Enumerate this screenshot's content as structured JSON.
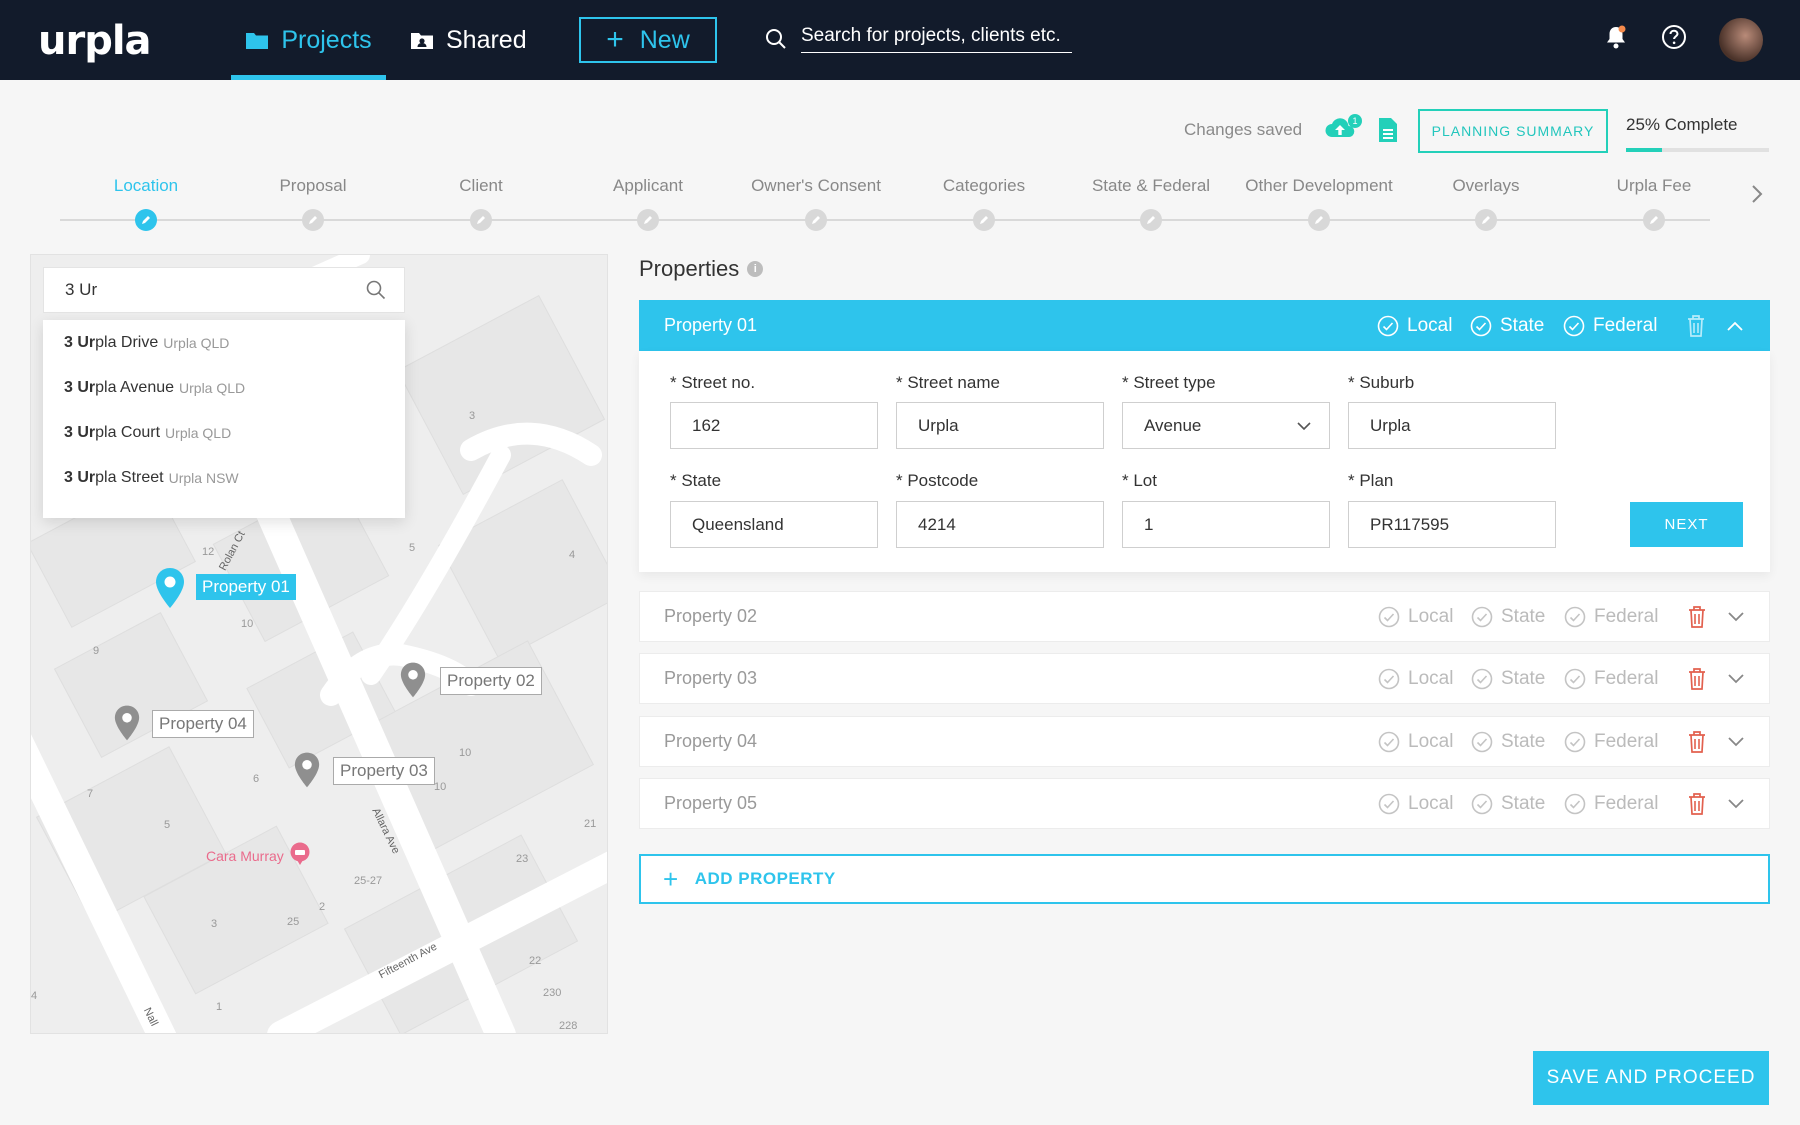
{
  "app": {
    "logo": "urpla"
  },
  "nav": {
    "projects_label": "Projects",
    "shared_label": "Shared",
    "new_label": "New",
    "search_placeholder": "Search for projects, clients etc."
  },
  "status": {
    "changes_saved": "Changes saved",
    "upload_badge": "1",
    "planning_summary": "PLANNING SUMMARY",
    "complete_text": "25% Complete",
    "complete_fraction": 0.25
  },
  "steps": [
    {
      "label": "Location",
      "active": true
    },
    {
      "label": "Proposal",
      "active": false
    },
    {
      "label": "Client",
      "active": false
    },
    {
      "label": "Applicant",
      "active": false
    },
    {
      "label": "Owner's Consent",
      "active": false
    },
    {
      "label": "Categories",
      "active": false
    },
    {
      "label": "State & Federal",
      "active": false
    },
    {
      "label": "Other Development",
      "active": false
    },
    {
      "label": "Overlays",
      "active": false
    },
    {
      "label": "Urpla Fee",
      "active": false
    }
  ],
  "map": {
    "search_value": "3 Ur",
    "suggestions": [
      {
        "bold": "3 Ur",
        "rest": "pla Drive",
        "sub": "Urpla QLD"
      },
      {
        "bold": "3 Ur",
        "rest": "pla Avenue",
        "sub": "Urpla QLD"
      },
      {
        "bold": "3 Ur",
        "rest": "pla Court",
        "sub": "Urpla QLD"
      },
      {
        "bold": "3 Ur",
        "rest": "pla Street",
        "sub": "Urpla NSW"
      }
    ],
    "pins": [
      "Property 01",
      "Property 02",
      "Property 03",
      "Property 04"
    ],
    "streets": [
      "Rolan Ct",
      "Allara Ave",
      "Fifteenth Ave",
      "Nall"
    ],
    "poi": "Cara Murray",
    "lot_numbers": [
      "12",
      "10",
      "9",
      "5",
      "3",
      "4",
      "10",
      "6",
      "7",
      "5",
      "3",
      "25",
      "2",
      "25-27",
      "10",
      "23",
      "21",
      "22",
      "230",
      "228",
      "1",
      "4"
    ]
  },
  "properties": {
    "title": "Properties",
    "active": {
      "name": "Property 01",
      "fields": {
        "street_no_label": "* Street no.",
        "street_no": "162",
        "street_name_label": "* Street name",
        "street_name": "Urpla",
        "street_type_label": "* Street type",
        "street_type": "Avenue",
        "suburb_label": "* Suburb",
        "suburb": "Urpla",
        "state_label": "* State",
        "state": "Queensland",
        "postcode_label": "* Postcode",
        "postcode": "4214",
        "lot_label": "* Lot",
        "lot": "1",
        "plan_label": "* Plan",
        "plan": "PR117595"
      },
      "next_label": "NEXT"
    },
    "jurisdictions": [
      "Local",
      "State",
      "Federal"
    ],
    "rows": [
      "Property 02",
      "Property 03",
      "Property 04",
      "Property 05"
    ],
    "add_label": "ADD PROPERTY"
  },
  "footer": {
    "save_label": "SAVE AND PROCEED"
  },
  "colors": {
    "accent": "#2ec4ec",
    "teal": "#23d0b9",
    "danger": "#e2604e",
    "nav_bg": "#121b2b"
  }
}
